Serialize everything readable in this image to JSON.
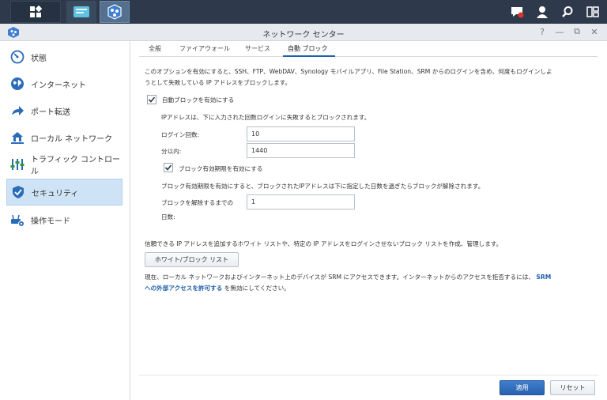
{
  "window": {
    "title": "ネットワーク センター",
    "controls": [
      "?",
      "—",
      "⧉",
      "✕"
    ]
  },
  "sidebar": {
    "items": [
      {
        "label": "状態",
        "icon": "speedometer-icon"
      },
      {
        "label": "インターネット",
        "icon": "globe-icon"
      },
      {
        "label": "ポート転送",
        "icon": "forward-arrow-icon"
      },
      {
        "label": "ローカル ネットワーク",
        "icon": "home-network-icon"
      },
      {
        "label": "トラフィック コントロール",
        "icon": "sliders-icon"
      },
      {
        "label": "セキュリティ",
        "icon": "shield-icon",
        "active": true
      },
      {
        "label": "操作モード",
        "icon": "router-gear-icon"
      }
    ]
  },
  "tabs": [
    {
      "label": "全般"
    },
    {
      "label": "ファイアウォール"
    },
    {
      "label": "サービス"
    },
    {
      "label": "自動 ブロック",
      "active": true
    }
  ],
  "autoblock": {
    "description_line1": "このオプションを有効にすると、SSH、FTP、WebDAV、Synology モバイルアプリ、File Station、SRM からのログインを含め、何度もログインしよ",
    "description_line2": "うとして失敗している IP アドレスをブロックします。",
    "enable_label": "自動ブロックを有効にする",
    "enable_checked": true,
    "ip_rule_text": "IPアドレスは、下に入力された回数ログインに失敗するとブロックされます。",
    "login_attempts_label": "ログイン回数:",
    "login_attempts_value": "10",
    "within_minutes_label": "分以内:",
    "within_minutes_value": "1440",
    "expiration_label": "ブロック有効期限を有効にする",
    "expiration_checked": true,
    "expiration_text": "ブロック有効期限を有効にすると、ブロックされたIPアドレスは下に指定した日数を過ぎたらブロックが解除されます。",
    "unblock_days_label_line1": "ブロックを解除するまでの",
    "unblock_days_label_line2": "日数:",
    "unblock_days_value": "1",
    "whitelist_text": "信頼できる IP アドレスを追加するホワイト リストや、特定の IP アドレスをログインさせないブロック リストを作成、管理します。",
    "whitelist_button": "ホワイト/ブロック リスト",
    "note_line1": "現在、ローカル ネットワークおよびインターネット上のデバイスが SRM にアクセスできます。インターネットからのアクセスを拒否するには、",
    "note_link_part1": "SRM",
    "note_link_part2": "への外部アクセスを許可する",
    "note_line2_tail": " を無効にしてください。"
  },
  "footer": {
    "apply_label": "適用",
    "reset_label": "リセット"
  },
  "colors": {
    "accent": "#1f5fa8",
    "taskbar": "#2e3a4b",
    "active_item": "#cfe3f6"
  }
}
